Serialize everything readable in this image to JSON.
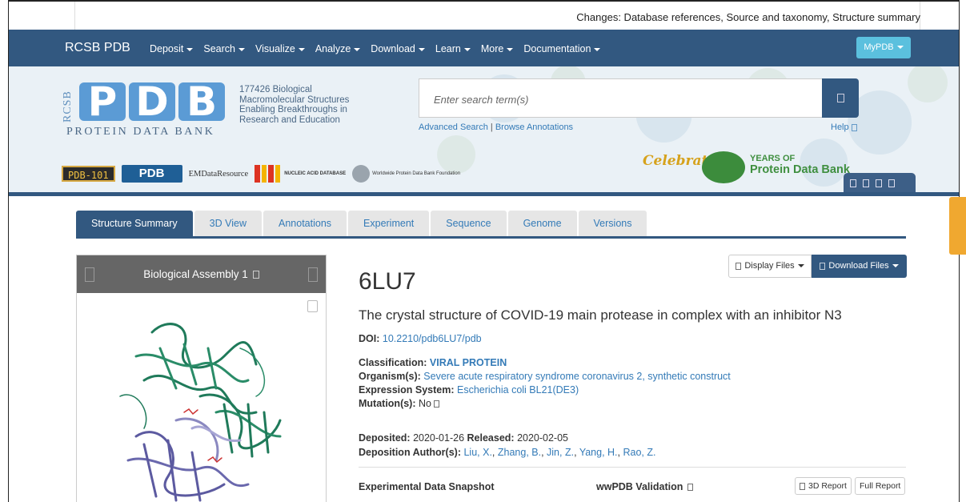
{
  "topbar": {
    "changes": "Changes: Database references, Source and taxonomy, Structure summary"
  },
  "nav": {
    "brand": "RCSB PDB",
    "items": [
      {
        "label": "Deposit",
        "dropdown": true
      },
      {
        "label": "Search",
        "dropdown": true
      },
      {
        "label": "Visualize",
        "dropdown": true
      },
      {
        "label": "Analyze",
        "dropdown": true
      },
      {
        "label": "Download",
        "dropdown": true
      },
      {
        "label": "Learn",
        "dropdown": true
      },
      {
        "label": "More",
        "dropdown": true
      },
      {
        "label": "Documentation",
        "dropdown": true
      }
    ],
    "mypdb": "MyPDB"
  },
  "header": {
    "logo_rcsb": "RCSB",
    "logo_letters": [
      "P",
      "D",
      "B"
    ],
    "logo_sub": "PROTEIN DATA BANK",
    "tagline": "177426 Biological Macromolecular Structures Enabling Breakthroughs in Research and Education",
    "search_placeholder": "Enter search term(s)",
    "advanced_search": "Advanced Search",
    "browse_annotations": "Browse Annotations",
    "help": "Help",
    "pdb101": "PDB-101",
    "wwpdb": "PDB",
    "emdb": "EMDataResource",
    "ndb": "NUCLEIC ACID DATABASE",
    "wwf": "Worldwide Protein Data Bank Foundation",
    "celebrating": "Celebrating",
    "years_of": "YEARS OF",
    "protein_data_bank": "Protein Data Bank"
  },
  "tabs": [
    "Structure Summary",
    "3D View",
    "Annotations",
    "Experiment",
    "Sequence",
    "Genome",
    "Versions"
  ],
  "viewer": {
    "title": "Biological Assembly 1"
  },
  "buttons": {
    "display_files": "Display Files",
    "download_files": "Download Files"
  },
  "entry": {
    "id": "6LU7",
    "title": "The crystal structure of COVID-19 main protease in complex with an inhibitor N3",
    "doi_label": "DOI:",
    "doi": "10.2210/pdb6LU7/pdb",
    "classification_label": "Classification:",
    "classification": "VIRAL PROTEIN",
    "organism_label": "Organism(s):",
    "organism": "Severe acute respiratory syndrome coronavirus 2, synthetic construct",
    "expression_label": "Expression System:",
    "expression": "Escherichia coli BL21(DE3)",
    "mutation_label": "Mutation(s):",
    "mutation": "No",
    "deposited_label": "Deposited:",
    "deposited": "2020-01-26",
    "released_label": "Released:",
    "released": "2020-02-05",
    "authors_label": "Deposition Author(s):",
    "authors": [
      "Liu, X.",
      "Zhang, B.",
      "Jin, Z.",
      "Yang, H.",
      "Rao, Z."
    ]
  },
  "sections": {
    "snapshot": "Experimental Data Snapshot",
    "validation": "wwPDB Validation",
    "report_3d": "3D Report",
    "report_full": "Full Report"
  }
}
